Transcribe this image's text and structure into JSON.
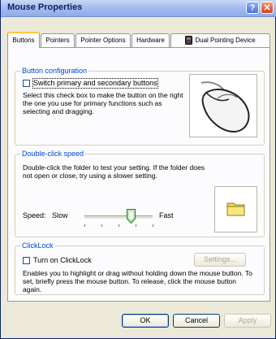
{
  "window": {
    "title": "Mouse Properties",
    "help_glyph": "?",
    "close_glyph": "✕"
  },
  "tabs": [
    {
      "label": "Buttons",
      "active": true
    },
    {
      "label": "Pointers"
    },
    {
      "label": "Pointer Options"
    },
    {
      "label": "Hardware"
    },
    {
      "label": "Dual Pointing Device"
    }
  ],
  "button_config": {
    "title": "Button configuration",
    "checkbox_label": "Switch primary and secondary buttons",
    "checked": false,
    "description": "Select this check box to make the button on the right the one you use for primary functions such as selecting and dragging."
  },
  "double_click": {
    "title": "Double-click speed",
    "description": "Double-click the folder to test your setting. If the folder does not open or close, try using a slower setting.",
    "speed_label": "Speed:",
    "slow_label": "Slow",
    "fast_label": "Fast",
    "slider_value_percent": 60
  },
  "clicklock": {
    "title": "ClickLock",
    "checkbox_label": "Turn on ClickLock",
    "checked": false,
    "settings_button": "Settings...",
    "description": "Enables you to highlight or drag without holding down the mouse button. To set, briefly press the mouse button. To release, click the mouse button again."
  },
  "footer": {
    "ok": "OK",
    "cancel": "Cancel",
    "apply": "Apply"
  },
  "colors": {
    "group_title": "#0046d5",
    "tab_highlight": "#ffc73c",
    "window_bg": "#ece9d8",
    "folder": "#f5d84c"
  }
}
